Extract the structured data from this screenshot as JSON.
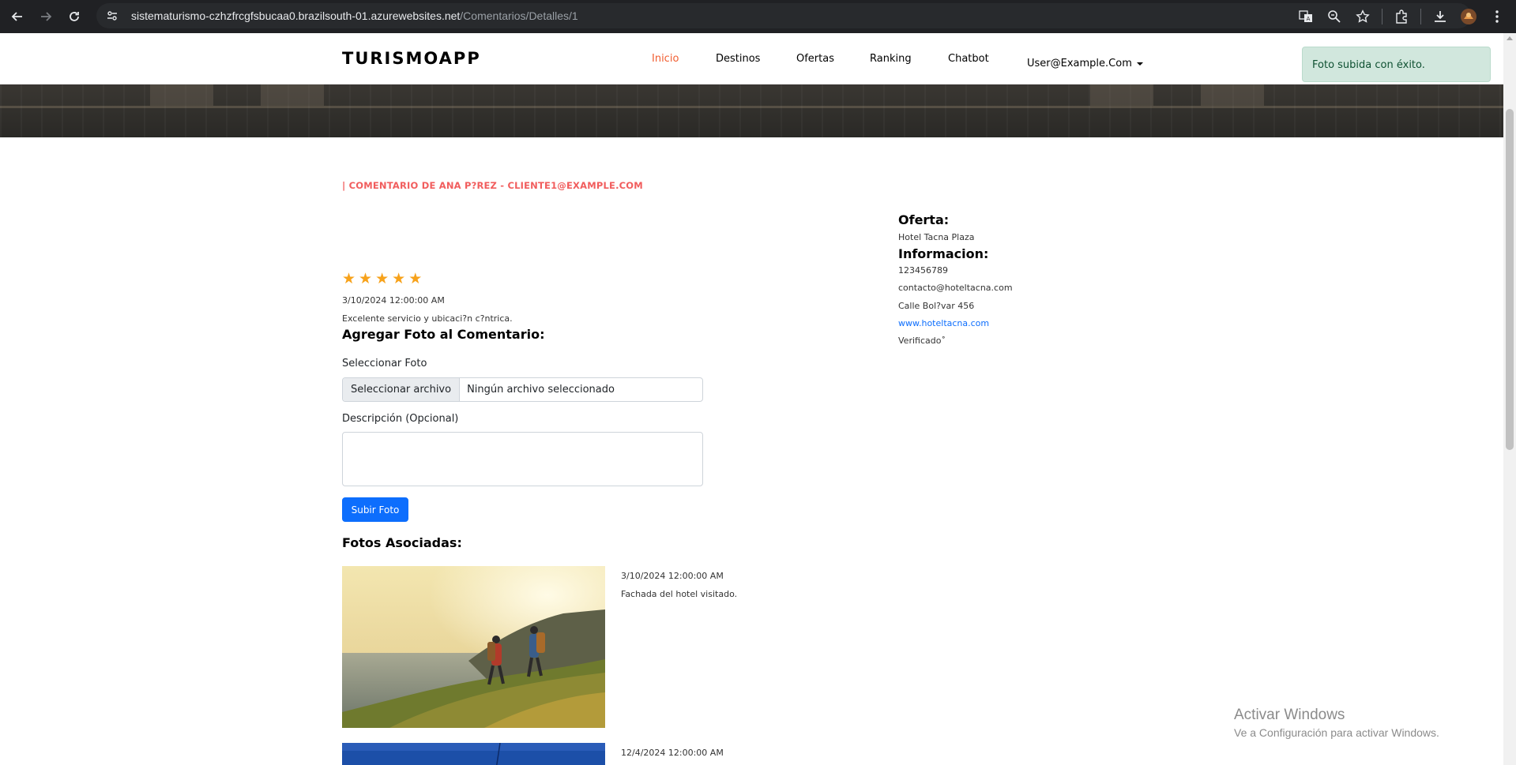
{
  "browser": {
    "url_host": "sistematurismo-czhzfrcgfsbucaa0.brazilsouth-01.azurewebsites.net",
    "url_path": "/Comentarios/Detalles/1"
  },
  "navbar": {
    "brand": "TURISMOAPP",
    "links": [
      {
        "label": "Inicio",
        "active": true
      },
      {
        "label": "Destinos",
        "active": false
      },
      {
        "label": "Ofertas",
        "active": false
      },
      {
        "label": "Ranking",
        "active": false
      },
      {
        "label": "Chatbot",
        "active": false
      }
    ],
    "user": "User@Example.Com"
  },
  "toast": {
    "message": "Foto subida con éxito."
  },
  "comment": {
    "title": "| COMENTARIO DE ANA P?REZ - CLIENTE1@EXAMPLE.COM",
    "rating": 5,
    "date": "3/10/2024 12:00:00 AM",
    "text": "Excelente servicio y ubicaci?n c?ntrica."
  },
  "upload_form": {
    "heading": "Agregar Foto al Comentario:",
    "file_label": "Seleccionar Foto",
    "file_button": "Seleccionar archivo",
    "file_status": "Ningún archivo seleccionado",
    "description_label": "Descripción (Opcional)",
    "description_value": "",
    "submit_label": "Subir Foto"
  },
  "photos": {
    "heading": "Fotos Asociadas:",
    "items": [
      {
        "date": "3/10/2024 12:00:00 AM",
        "description": "Fachada del hotel visitado."
      },
      {
        "date": "12/4/2024 12:00:00 AM",
        "description": ""
      }
    ]
  },
  "offer": {
    "heading": "Oferta:",
    "name": "Hotel Tacna Plaza",
    "info_heading": "Informacion:",
    "phone": "123456789",
    "email": "contacto@hoteltacna.com",
    "address": "Calle Bol?var 456",
    "website": "www.hoteltacna.com",
    "status": "Verificado˚"
  },
  "watermark": {
    "line1": "Activar Windows",
    "line2": "Ve a Configuración para activar Windows."
  },
  "colors": {
    "accent": "#f15d30",
    "title_red": "#f15d5d",
    "star": "#f7a21b",
    "primary": "#0d6efd",
    "toast_bg": "#d1e7dd",
    "toast_text": "#0f5132"
  }
}
